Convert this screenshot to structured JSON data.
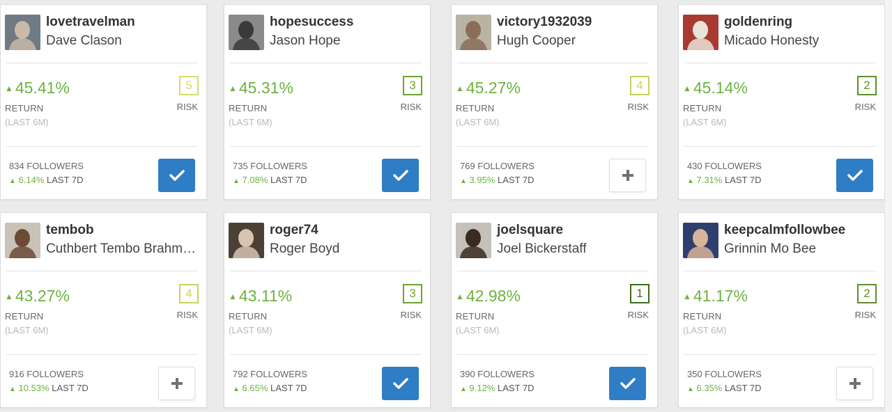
{
  "colors": {
    "gain_green": "#6cb33f",
    "follow_blue": "#2f7dc4",
    "risk_1": "#3d6e1f",
    "risk_2": "#5e8f2a",
    "risk_3": "#6ea32f",
    "risk_4": "#c7d35a",
    "risk_5": "#d8dc6c"
  },
  "labels": {
    "return": "RETURN",
    "return_period": "(LAST 6M)",
    "risk": "RISK",
    "gain_suffix": "LAST 7D"
  },
  "icons": {
    "gain_arrow": "up-arrow-icon",
    "follow_checked": "checkmark-icon",
    "follow_add": "plus-icon"
  },
  "investors": [
    {
      "username": "lovetravelman",
      "full_name": "Dave Clason",
      "return": "45.41%",
      "risk": "5",
      "followers": "834 FOLLOWERS",
      "gain": "6.14%",
      "following": true,
      "avatar_bg": "#6f7a84",
      "avatar_fg": "#c9b9a6"
    },
    {
      "username": "hopesuccess",
      "full_name": "Jason Hope",
      "return": "45.31%",
      "risk": "3",
      "followers": "735 FOLLOWERS",
      "gain": "7.08%",
      "following": true,
      "avatar_bg": "#8a8a8a",
      "avatar_fg": "#3a3a3a"
    },
    {
      "username": "victory1932039",
      "full_name": "Hugh Cooper",
      "return": "45.27%",
      "risk": "4",
      "followers": "769 FOLLOWERS",
      "gain": "3.95%",
      "following": false,
      "avatar_bg": "#b9b3a6",
      "avatar_fg": "#8a6d58"
    },
    {
      "username": "goldenring",
      "full_name": "Micado Honesty",
      "return": "45.14%",
      "risk": "2",
      "followers": "430 FOLLOWERS",
      "gain": "7.31%",
      "following": true,
      "avatar_bg": "#a83a32",
      "avatar_fg": "#e9e4d8"
    },
    {
      "username": "tembob",
      "full_name": "Cuthbert Tembo Brahmanyaya",
      "return": "43.27%",
      "risk": "4",
      "followers": "916 FOLLOWERS",
      "gain": "10.53%",
      "following": false,
      "avatar_bg": "#c9c2b6",
      "avatar_fg": "#6b4a36"
    },
    {
      "username": "roger74",
      "full_name": "Roger Boyd",
      "return": "43.11%",
      "risk": "3",
      "followers": "792 FOLLOWERS",
      "gain": "6.65%",
      "following": true,
      "avatar_bg": "#4a4036",
      "avatar_fg": "#d6c4b0"
    },
    {
      "username": "joelsquare",
      "full_name": "Joel Bickerstaff",
      "return": "42.98%",
      "risk": "1",
      "followers": "390 FOLLOWERS",
      "gain": "9.12%",
      "following": true,
      "avatar_bg": "#c4c0ba",
      "avatar_fg": "#3a2a20"
    },
    {
      "username": "keepcalmfollowbee",
      "full_name": "Grinnin Mo Bee",
      "return": "41.17%",
      "risk": "2",
      "followers": "350 FOLLOWERS",
      "gain": "6.35%",
      "following": false,
      "avatar_bg": "#2e3f6e",
      "avatar_fg": "#d9b49a"
    }
  ]
}
